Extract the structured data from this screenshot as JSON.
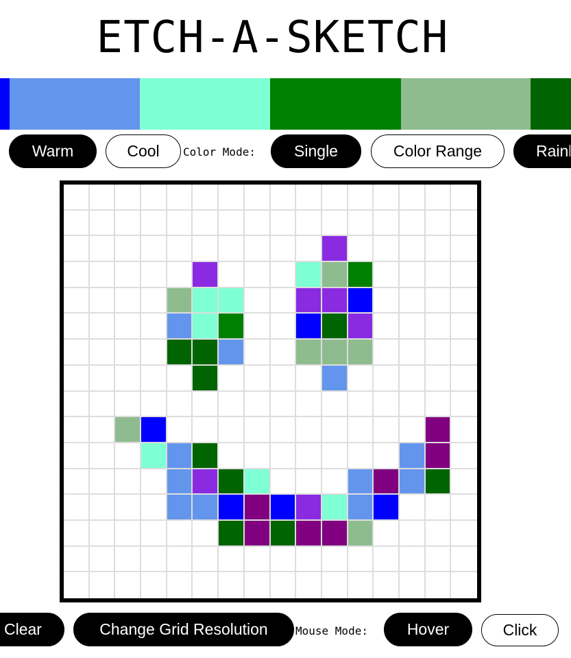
{
  "title": "ETCH-A-SKETCH",
  "palette": [
    {
      "color": "#0000ff"
    },
    {
      "color": "#6495ed"
    },
    {
      "color": "#7fffd4"
    },
    {
      "color": "#008000"
    },
    {
      "color": "#8fbc8f"
    },
    {
      "color": "#006400"
    }
  ],
  "palette_controls": {
    "warm_label": "Warm",
    "cool_label": "Cool",
    "color_mode_label": "Color Mode:",
    "single_label": "Single",
    "color_range_label": "Color Range",
    "rainbow_label": "Rainbow"
  },
  "grid": {
    "resolution": 16,
    "line_color": "#dddddd",
    "border_color": "#000000",
    "cells": [
      [
        "",
        "",
        "",
        "",
        "",
        "",
        "",
        "",
        "",
        "",
        "",
        "",
        "",
        "",
        "",
        ""
      ],
      [
        "",
        "",
        "",
        "",
        "",
        "",
        "",
        "",
        "",
        "",
        "",
        "",
        "",
        "",
        "",
        ""
      ],
      [
        "",
        "",
        "",
        "",
        "",
        "",
        "",
        "",
        "",
        "",
        "#8a2be2",
        "",
        "",
        "",
        "",
        ""
      ],
      [
        "",
        "",
        "",
        "",
        "",
        "#8a2be2",
        "",
        "",
        "",
        "#7fffd4",
        "#8fbc8f",
        "#008000",
        "",
        "",
        "",
        ""
      ],
      [
        "",
        "",
        "",
        "",
        "#8fbc8f",
        "#7fffd4",
        "#7fffd4",
        "",
        "",
        "#8a2be2",
        "#8a2be2",
        "#0000ff",
        "",
        "",
        "",
        ""
      ],
      [
        "",
        "",
        "",
        "",
        "#6495ed",
        "#7fffd4",
        "#008000",
        "",
        "",
        "#0000ff",
        "#006400",
        "#8a2be2",
        "",
        "",
        "",
        ""
      ],
      [
        "",
        "",
        "",
        "",
        "#006400",
        "#006400",
        "#6495ed",
        "",
        "",
        "#8fbc8f",
        "#8fbc8f",
        "#8fbc8f",
        "",
        "",
        "",
        ""
      ],
      [
        "",
        "",
        "",
        "",
        "",
        "#006400",
        "",
        "",
        "",
        "",
        "#6495ed",
        "",
        "",
        "",
        "",
        ""
      ],
      [
        "",
        "",
        "",
        "",
        "",
        "",
        "",
        "",
        "",
        "",
        "",
        "",
        "",
        "",
        "",
        ""
      ],
      [
        "",
        "",
        "#8fbc8f",
        "#0000ff",
        "",
        "",
        "",
        "",
        "",
        "",
        "",
        "",
        "",
        "",
        "#800080",
        ""
      ],
      [
        "",
        "",
        "",
        "#7fffd4",
        "#6495ed",
        "#006400",
        "",
        "",
        "",
        "",
        "",
        "",
        "",
        "#6495ed",
        "#800080",
        ""
      ],
      [
        "",
        "",
        "",
        "",
        "#6495ed",
        "#8a2be2",
        "#006400",
        "#7fffd4",
        "",
        "",
        "",
        "#6495ed",
        "#800080",
        "#6495ed",
        "#006400",
        ""
      ],
      [
        "",
        "",
        "",
        "",
        "#6495ed",
        "#6495ed",
        "#0000ff",
        "#800080",
        "#0000ff",
        "#8a2be2",
        "#7fffd4",
        "#6495ed",
        "#0000ff",
        "",
        "",
        ""
      ],
      [
        "",
        "",
        "",
        "",
        "",
        "",
        "#006400",
        "#800080",
        "#006400",
        "#800080",
        "#800080",
        "#8fbc8f",
        "",
        "",
        "",
        ""
      ],
      [
        "",
        "",
        "",
        "",
        "",
        "",
        "",
        "",
        "",
        "",
        "",
        "",
        "",
        "",
        "",
        ""
      ],
      [
        "",
        "",
        "",
        "",
        "",
        "",
        "",
        "",
        "",
        "",
        "",
        "",
        "",
        "",
        "",
        ""
      ]
    ]
  },
  "bottom_controls": {
    "clear_label": "Clear",
    "change_grid_label": "Change Grid Resolution",
    "mouse_mode_label": "Mouse Mode:",
    "hover_label": "Hover",
    "click_label": "Click"
  }
}
